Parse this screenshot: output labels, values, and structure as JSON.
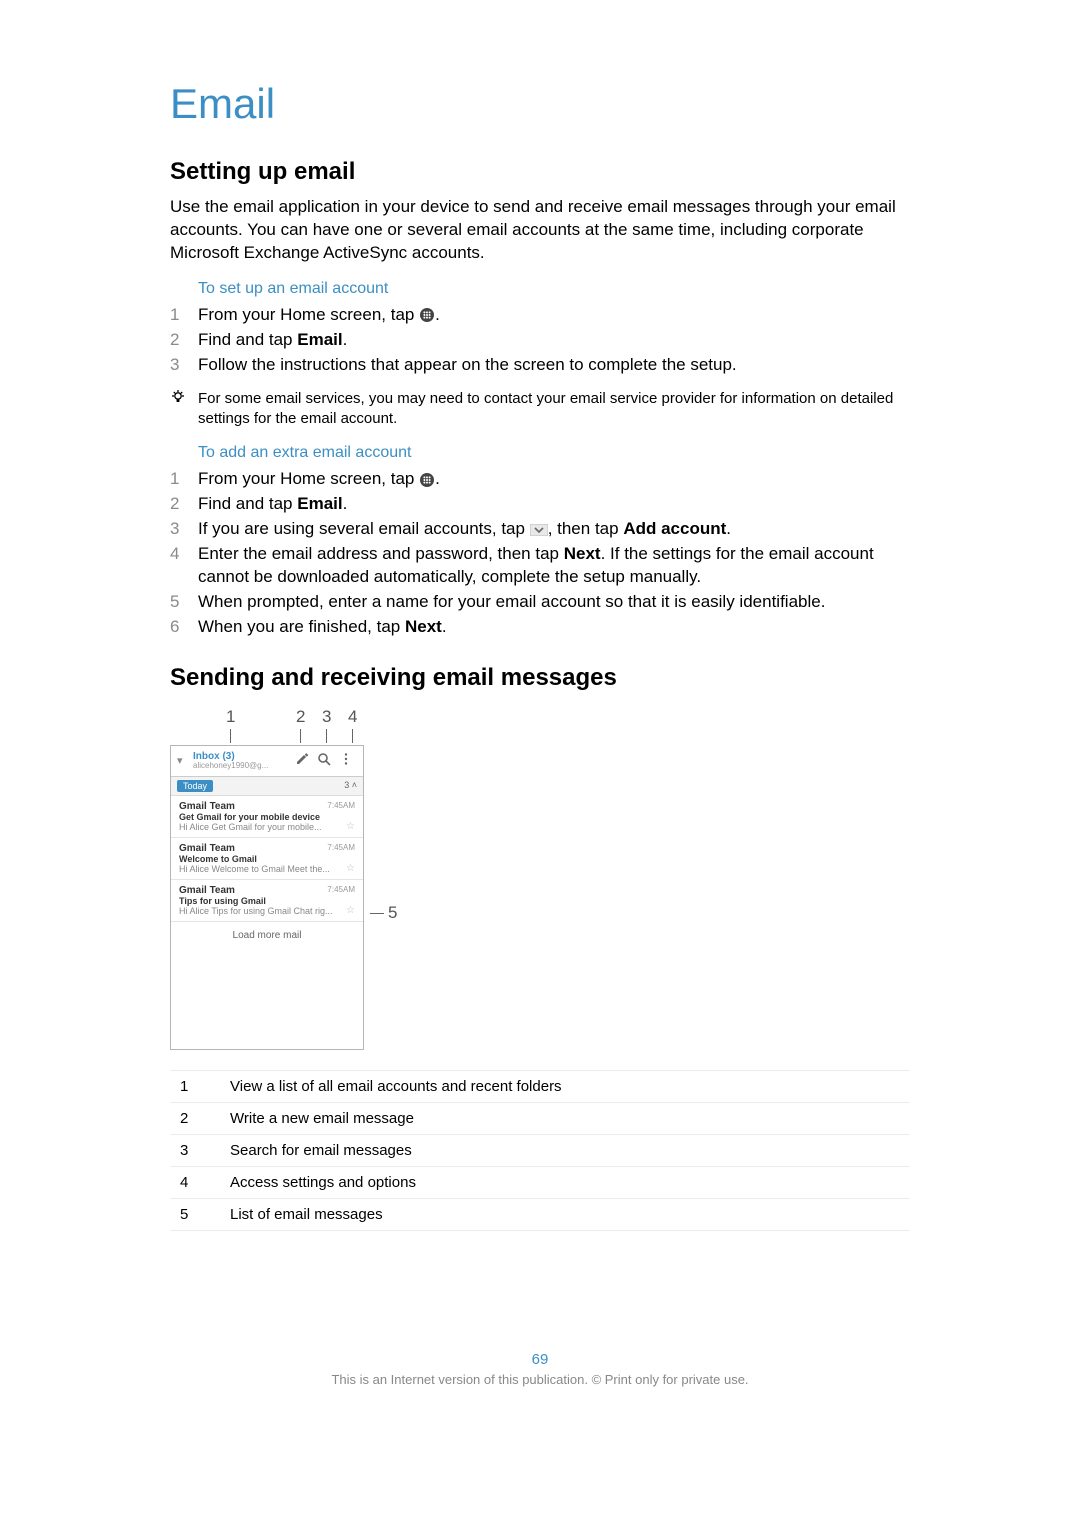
{
  "title": "Email",
  "section1": {
    "heading": "Setting up email",
    "intro": "Use the email application in your device to send and receive email messages through your email accounts. You can have one or several email accounts at the same time, including corporate Microsoft Exchange ActiveSync accounts.",
    "sub1_head": "To set up an email account",
    "sub1_steps": [
      {
        "n": "1",
        "pre": "From your Home screen, tap ",
        "icon": "apps-icon",
        "post": "."
      },
      {
        "n": "2",
        "pre": "Find and tap ",
        "bold": "Email",
        "post": "."
      },
      {
        "n": "3",
        "pre": "Follow the instructions that appear on the screen to complete the setup."
      }
    ],
    "tip": "For some email services, you may need to contact your email service provider for information on detailed settings for the email account.",
    "sub2_head": "To add an extra email account",
    "sub2_steps": {
      "s1": {
        "n": "1",
        "pre": "From your Home screen, tap ",
        "post": "."
      },
      "s2": {
        "n": "2",
        "pre": "Find and tap ",
        "bold": "Email",
        "post": "."
      },
      "s3": {
        "n": "3",
        "a": "If you are using several email accounts, tap ",
        "b": ", then tap ",
        "bold": "Add account",
        "c": "."
      },
      "s4": {
        "n": "4",
        "a": "Enter the email address and password, then tap ",
        "bold": "Next",
        "b": ". If the settings for the email account cannot be downloaded automatically, complete the setup manually."
      },
      "s5": {
        "n": "5",
        "a": "When prompted, enter a name for your email account so that it is easily identifiable."
      },
      "s6": {
        "n": "6",
        "a": "When you are finished, tap ",
        "bold": "Next",
        "b": "."
      }
    }
  },
  "section2": {
    "heading": "Sending and receiving email messages"
  },
  "figure": {
    "labels": {
      "l1": "1",
      "l2": "2",
      "l3": "3",
      "l4": "4",
      "l5": "5"
    },
    "inbox_label": "Inbox",
    "inbox_count": "(3)",
    "account_sub": "alicehoney1990@g...",
    "today": "Today",
    "today_count": "3",
    "messages": [
      {
        "from": "Gmail Team",
        "subj": "Get Gmail for your mobile device",
        "prev": "Hi Alice Get Gmail for your mobile...",
        "time": "7:45AM"
      },
      {
        "from": "Gmail Team",
        "subj": "Welcome to Gmail",
        "prev": "Hi Alice Welcome to Gmail Meet the...",
        "time": "7:45AM"
      },
      {
        "from": "Gmail Team",
        "subj": "Tips for using Gmail",
        "prev": "Hi Alice Tips for using Gmail Chat rig...",
        "time": "7:45AM"
      }
    ],
    "load_more": "Load more mail"
  },
  "callouts": [
    {
      "n": "1",
      "text": "View a list of all email accounts and recent folders"
    },
    {
      "n": "2",
      "text": "Write a new email message"
    },
    {
      "n": "3",
      "text": "Search for email messages"
    },
    {
      "n": "4",
      "text": "Access settings and options"
    },
    {
      "n": "5",
      "text": "List of email messages"
    }
  ],
  "page_number": "69",
  "footer": "This is an Internet version of this publication. © Print only for private use."
}
